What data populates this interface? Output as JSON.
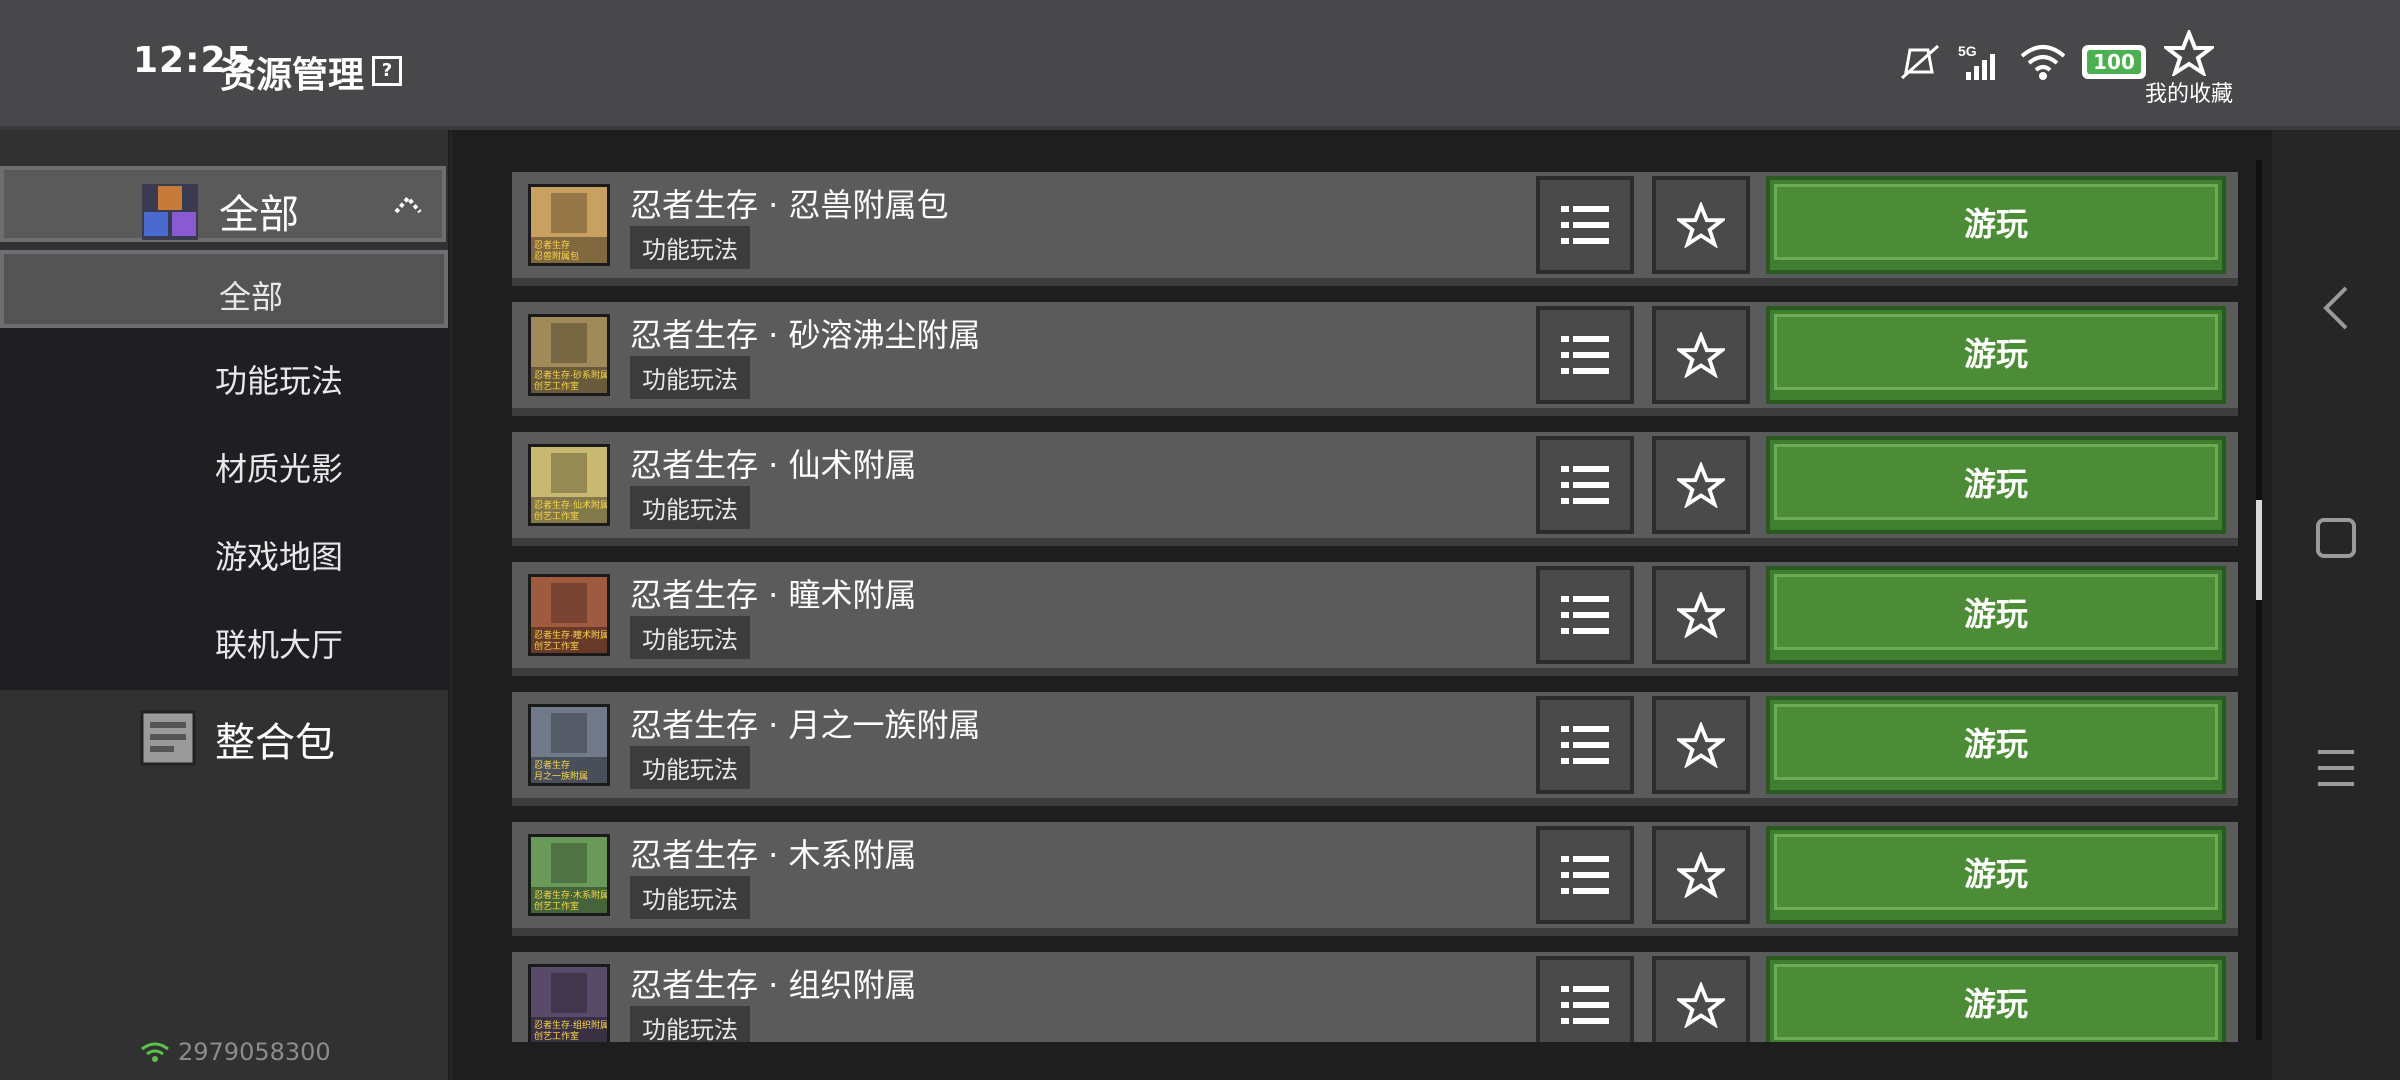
{
  "statusbar": {
    "time": "12:25",
    "network": "5G",
    "battery": "100"
  },
  "header": {
    "title": "资源管理",
    "help": "?",
    "favorites_label": "我的收藏"
  },
  "sidebar": {
    "category": "全部",
    "subitems": [
      "全部",
      "功能玩法",
      "材质光影",
      "游戏地图",
      "联机大厅"
    ],
    "selected_subitem": "全部",
    "pack": "整合包",
    "account_id": "2979058300"
  },
  "list": {
    "play_label": "游玩",
    "items": [
      {
        "name": "忍者生存 · 忍兽附属包",
        "tag": "功能玩法",
        "thumb_text": "忍者生存\n忍兽附属包",
        "thumb_color": "#c8a060"
      },
      {
        "name": "忍者生存 · 砂溶沸尘附属",
        "tag": "功能玩法",
        "thumb_text": "忍者生存·砂系附属\n创艺工作室",
        "thumb_color": "#a08a5a"
      },
      {
        "name": "忍者生存 · 仙术附属",
        "tag": "功能玩法",
        "thumb_text": "忍者生存·仙术附属\n创艺工作室",
        "thumb_color": "#c8b870"
      },
      {
        "name": "忍者生存 · 瞳术附属",
        "tag": "功能玩法",
        "thumb_text": "忍者生存·瞳术附属\n创艺工作室",
        "thumb_color": "#a05a40"
      },
      {
        "name": "忍者生存 · 月之一族附属",
        "tag": "功能玩法",
        "thumb_text": "忍者生存\n月之一族附属",
        "thumb_color": "#707a8a"
      },
      {
        "name": "忍者生存 · 木系附属",
        "tag": "功能玩法",
        "thumb_text": "忍者生存·木系附属\n创艺工作室",
        "thumb_color": "#6a9a5a"
      },
      {
        "name": "忍者生存 · 组织附属",
        "tag": "功能玩法",
        "thumb_text": "忍者生存·组织附属\n创艺工作室",
        "thumb_color": "#5a4a6a"
      }
    ]
  },
  "colors": {
    "play": "#4c8c36",
    "panel": "#5b5b5c",
    "bar": "#48484a"
  }
}
